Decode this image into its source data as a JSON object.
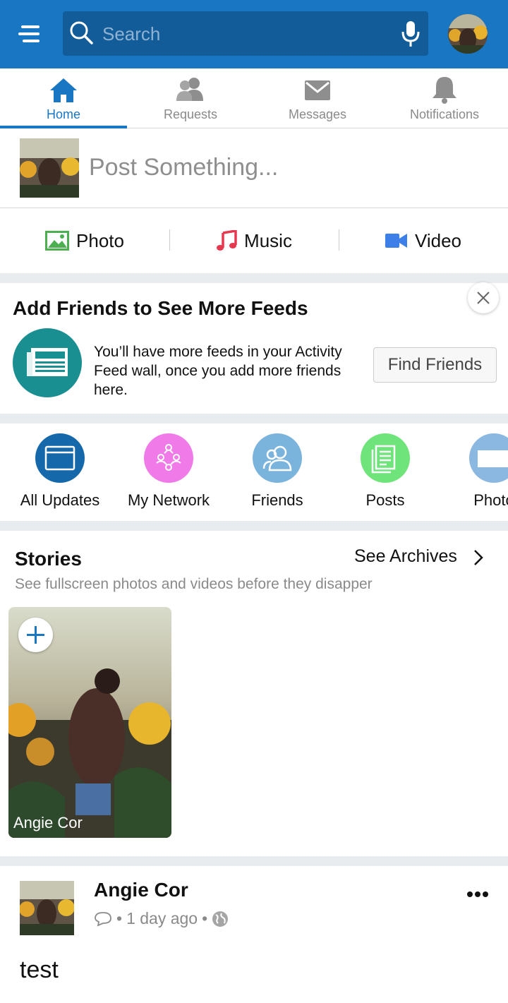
{
  "search": {
    "placeholder": "Search"
  },
  "tabs": [
    {
      "label": "Home",
      "icon": "home-icon",
      "active": true
    },
    {
      "label": "Requests",
      "icon": "people-icon",
      "active": false
    },
    {
      "label": "Messages",
      "icon": "envelope-icon",
      "active": false
    },
    {
      "label": "Notifications",
      "icon": "bell-icon",
      "active": false
    }
  ],
  "composer": {
    "placeholder": "Post Something..."
  },
  "attachments": [
    {
      "label": "Photo",
      "icon": "photo-icon",
      "color": "#4caf50"
    },
    {
      "label": "Music",
      "icon": "music-note-icon",
      "color": "#e53950"
    },
    {
      "label": "Video",
      "icon": "video-camera-icon",
      "color": "#3d7fe8"
    }
  ],
  "add_friends": {
    "title": "Add Friends to See More Feeds",
    "description": "You’ll have more feeds in your Activity Feed wall, once you add more friends here.",
    "button": "Find Friends"
  },
  "categories": [
    {
      "label": "All Updates",
      "icon": "browser-window-icon",
      "color": "#1569ab"
    },
    {
      "label": "My Network",
      "icon": "network-icon",
      "color": "#f07be8"
    },
    {
      "label": "Friends",
      "icon": "friends-icon",
      "color": "#7ab4dd"
    },
    {
      "label": "Posts",
      "icon": "document-icon",
      "color": "#6ee47a"
    },
    {
      "label": "Photo",
      "icon": "photo-icon",
      "color": "#8ab8e0"
    }
  ],
  "stories": {
    "title": "Stories",
    "see_archives": "See Archives",
    "subtitle": "See fullscreen photos and videos before they disapper",
    "items": [
      {
        "name": "Angie Cor"
      }
    ]
  },
  "post": {
    "author": "Angie Cor",
    "time": "1 day ago",
    "text": "test"
  },
  "colors": {
    "brand": "#1976c2",
    "search_bg": "#125c99"
  }
}
